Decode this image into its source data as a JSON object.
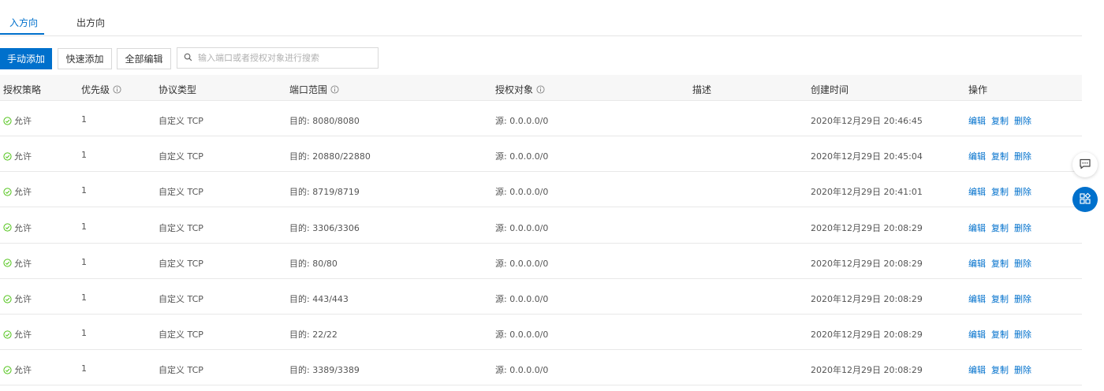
{
  "tabs": [
    {
      "label": "入方向",
      "active": true
    },
    {
      "label": "出方向",
      "active": false
    }
  ],
  "toolbar": {
    "manual_add": "手动添加",
    "quick_add": "快速添加",
    "bulk_edit": "全部编辑",
    "search_placeholder": "输入端口或者授权对象进行搜索"
  },
  "columns": [
    "授权策略",
    "优先级",
    "协议类型",
    "端口范围",
    "授权对象",
    "描述",
    "创建时间",
    "操作"
  ],
  "actions": {
    "edit": "编辑",
    "copy": "复制",
    "delete": "删除"
  },
  "rows": [
    {
      "policy": "允许",
      "priority": "1",
      "protocol": "自定义 TCP",
      "port": "目的: 8080/8080",
      "source": "源: 0.0.0.0/0",
      "desc": "",
      "created": "2020年12月29日 20:46:45"
    },
    {
      "policy": "允许",
      "priority": "1",
      "protocol": "自定义 TCP",
      "port": "目的: 20880/22880",
      "source": "源: 0.0.0.0/0",
      "desc": "",
      "created": "2020年12月29日 20:45:04"
    },
    {
      "policy": "允许",
      "priority": "1",
      "protocol": "自定义 TCP",
      "port": "目的: 8719/8719",
      "source": "源: 0.0.0.0/0",
      "desc": "",
      "created": "2020年12月29日 20:41:01"
    },
    {
      "policy": "允许",
      "priority": "1",
      "protocol": "自定义 TCP",
      "port": "目的: 3306/3306",
      "source": "源: 0.0.0.0/0",
      "desc": "",
      "created": "2020年12月29日 20:08:29"
    },
    {
      "policy": "允许",
      "priority": "1",
      "protocol": "自定义 TCP",
      "port": "目的: 80/80",
      "source": "源: 0.0.0.0/0",
      "desc": "",
      "created": "2020年12月29日 20:08:29"
    },
    {
      "policy": "允许",
      "priority": "1",
      "protocol": "自定义 TCP",
      "port": "目的: 443/443",
      "source": "源: 0.0.0.0/0",
      "desc": "",
      "created": "2020年12月29日 20:08:29"
    },
    {
      "policy": "允许",
      "priority": "1",
      "protocol": "自定义 TCP",
      "port": "目的: 22/22",
      "source": "源: 0.0.0.0/0",
      "desc": "",
      "created": "2020年12月29日 20:08:29"
    },
    {
      "policy": "允许",
      "priority": "1",
      "protocol": "自定义 TCP",
      "port": "目的: 3389/3389",
      "source": "源: 0.0.0.0/0",
      "desc": "",
      "created": "2020年12月29日 20:08:29"
    }
  ],
  "colors": {
    "accent": "#0070cc",
    "allow": "#52c41a"
  }
}
